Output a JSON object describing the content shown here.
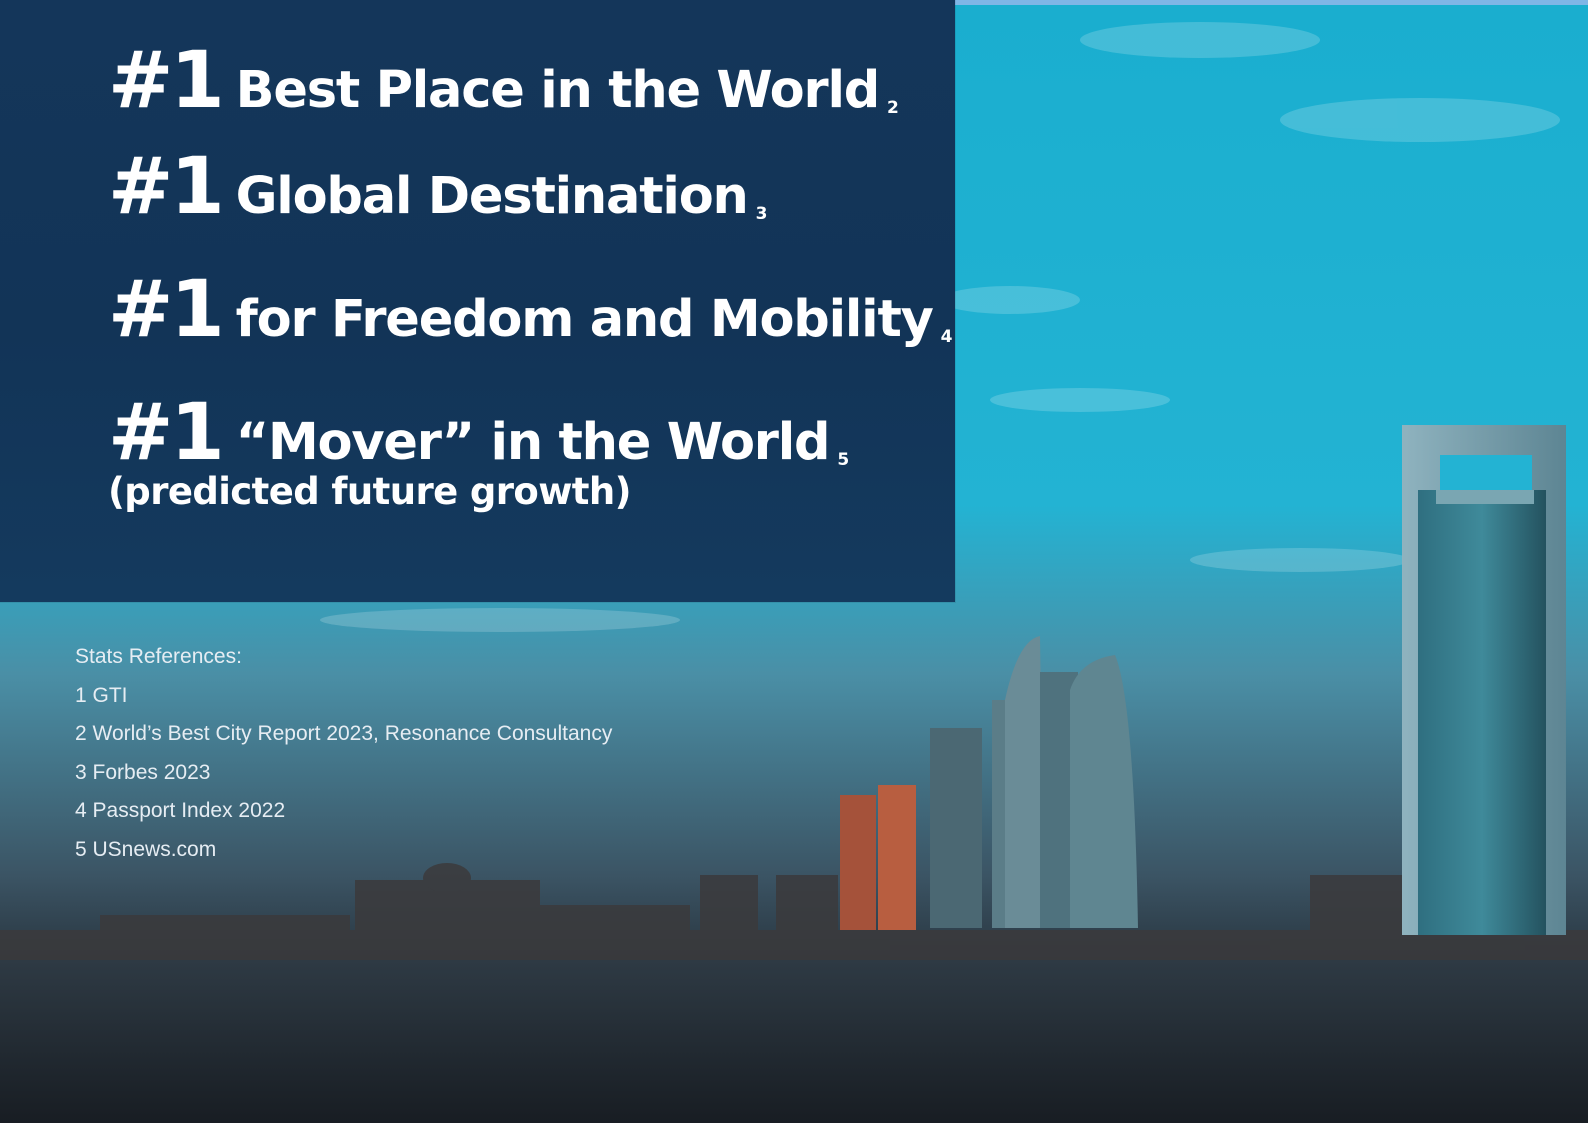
{
  "stats": [
    {
      "rank": "#1",
      "label": "Best Place in the World",
      "ref": "2"
    },
    {
      "rank": "#1",
      "label": "Global Destination",
      "ref": "3"
    },
    {
      "rank": "#1",
      "label": "for Freedom and Mobility",
      "ref": "4"
    },
    {
      "rank": "#1",
      "label": "“Mover” in the World",
      "ref": "5",
      "sub": "(predicted future growth)"
    }
  ],
  "references": {
    "title": "Stats References:",
    "items": [
      "1 GTI",
      "2 World’s Best City Report 2023, Resonance Consultancy",
      "3 Forbes 2023",
      "4 Passport Index 2022",
      "5 USnews.com"
    ]
  },
  "colors": {
    "panel": "#13355a",
    "sky": "#1fb0d0",
    "water": "#1c2530"
  }
}
